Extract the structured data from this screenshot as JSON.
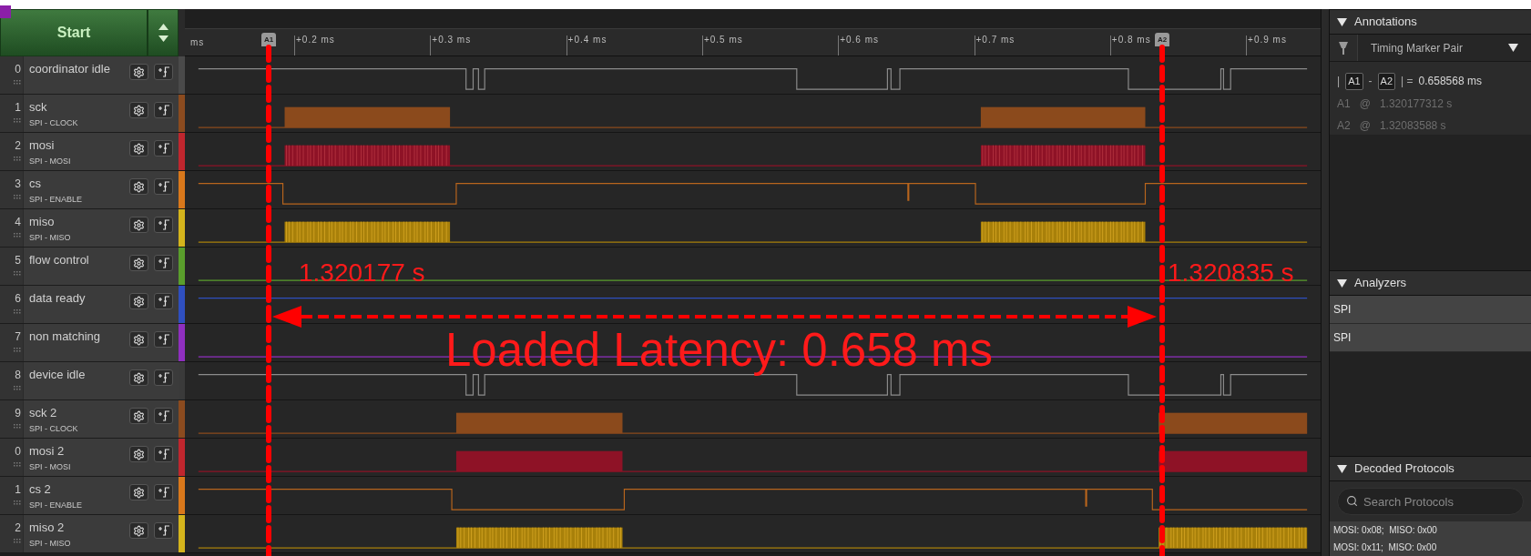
{
  "capture": {
    "start_label": "Start"
  },
  "ruler": {
    "unit": "ms",
    "ticks": [
      "+0.2 ms",
      "+0.3 ms",
      "+0.4 ms",
      "+0.5 ms",
      "+0.6 ms",
      "+0.7 ms",
      "+0.8 ms",
      "+0.9 ms"
    ]
  },
  "markers": [
    {
      "label": "A1",
      "time": "1.320177 s"
    },
    {
      "label": "A2",
      "time": "1.320835 s"
    }
  ],
  "measurement": {
    "text": "Loaded Latency: 0.658 ms"
  },
  "channels": [
    {
      "number": "0",
      "name": "coordinator idle",
      "kind": "idle",
      "color": "#4a4a4a"
    },
    {
      "number": "1",
      "name": "sck",
      "analyzer": "SPI - CLOCK",
      "kind": "clock",
      "color": "#8b4b1f"
    },
    {
      "number": "2",
      "name": "mosi",
      "analyzer": "SPI - MOSI",
      "kind": "data",
      "color": "#c0262e"
    },
    {
      "number": "3",
      "name": "cs",
      "analyzer": "SPI - ENABLE",
      "kind": "enable",
      "color": "#d9781b"
    },
    {
      "number": "4",
      "name": "miso",
      "analyzer": "SPI - MISO",
      "kind": "data",
      "color": "#d4b41c"
    },
    {
      "number": "5",
      "name": "flow control",
      "kind": "low",
      "color": "#5a9e2c"
    },
    {
      "number": "6",
      "name": "data ready",
      "kind": "high",
      "color": "#2f4fbf"
    },
    {
      "number": "7",
      "name": "non matching",
      "kind": "low",
      "color": "#8f2fbf"
    },
    {
      "number": "8",
      "name": "device idle",
      "kind": "idle",
      "color": "#3a3a3a"
    },
    {
      "number": "9",
      "name": "sck 2",
      "analyzer": "SPI - CLOCK",
      "kind": "clock",
      "color": "#8b4b1f"
    },
    {
      "number": "0",
      "name": "mosi 2",
      "analyzer": "SPI - MOSI",
      "kind": "data",
      "color": "#c0262e"
    },
    {
      "number": "1",
      "name": "cs 2",
      "analyzer": "SPI - ENABLE",
      "kind": "enable",
      "color": "#d9781b"
    },
    {
      "number": "2",
      "name": "miso 2",
      "analyzer": "SPI - MISO",
      "kind": "data",
      "color": "#d4b41c"
    }
  ],
  "annotations": {
    "title": "Annotations",
    "marker_pair": "Timing Marker Pair",
    "difference": [
      {
        "kind": "text",
        "text": "|"
      },
      {
        "kind": "badge",
        "text": "A1"
      },
      {
        "kind": "text",
        "text": "-"
      },
      {
        "kind": "badge",
        "text": "A2"
      },
      {
        "kind": "text",
        "text": "| ="
      },
      {
        "kind": "value",
        "text": "0.658568 ms"
      }
    ],
    "times": [
      {
        "marker": "A1",
        "sep": "@",
        "at": "1.320177312 s"
      },
      {
        "marker": "A2",
        "sep": "@",
        "at": "1.32083588 s"
      }
    ]
  },
  "analyzers": {
    "title": "Analyzers",
    "items": [
      "SPI",
      "SPI"
    ]
  },
  "decoded": {
    "title": "Decoded Protocols",
    "search_placeholder": "Search Protocols",
    "rows": [
      "MOSI: 0x08;  MISO: 0x00",
      "MOSI: 0x11;  MISO: 0x00"
    ]
  }
}
